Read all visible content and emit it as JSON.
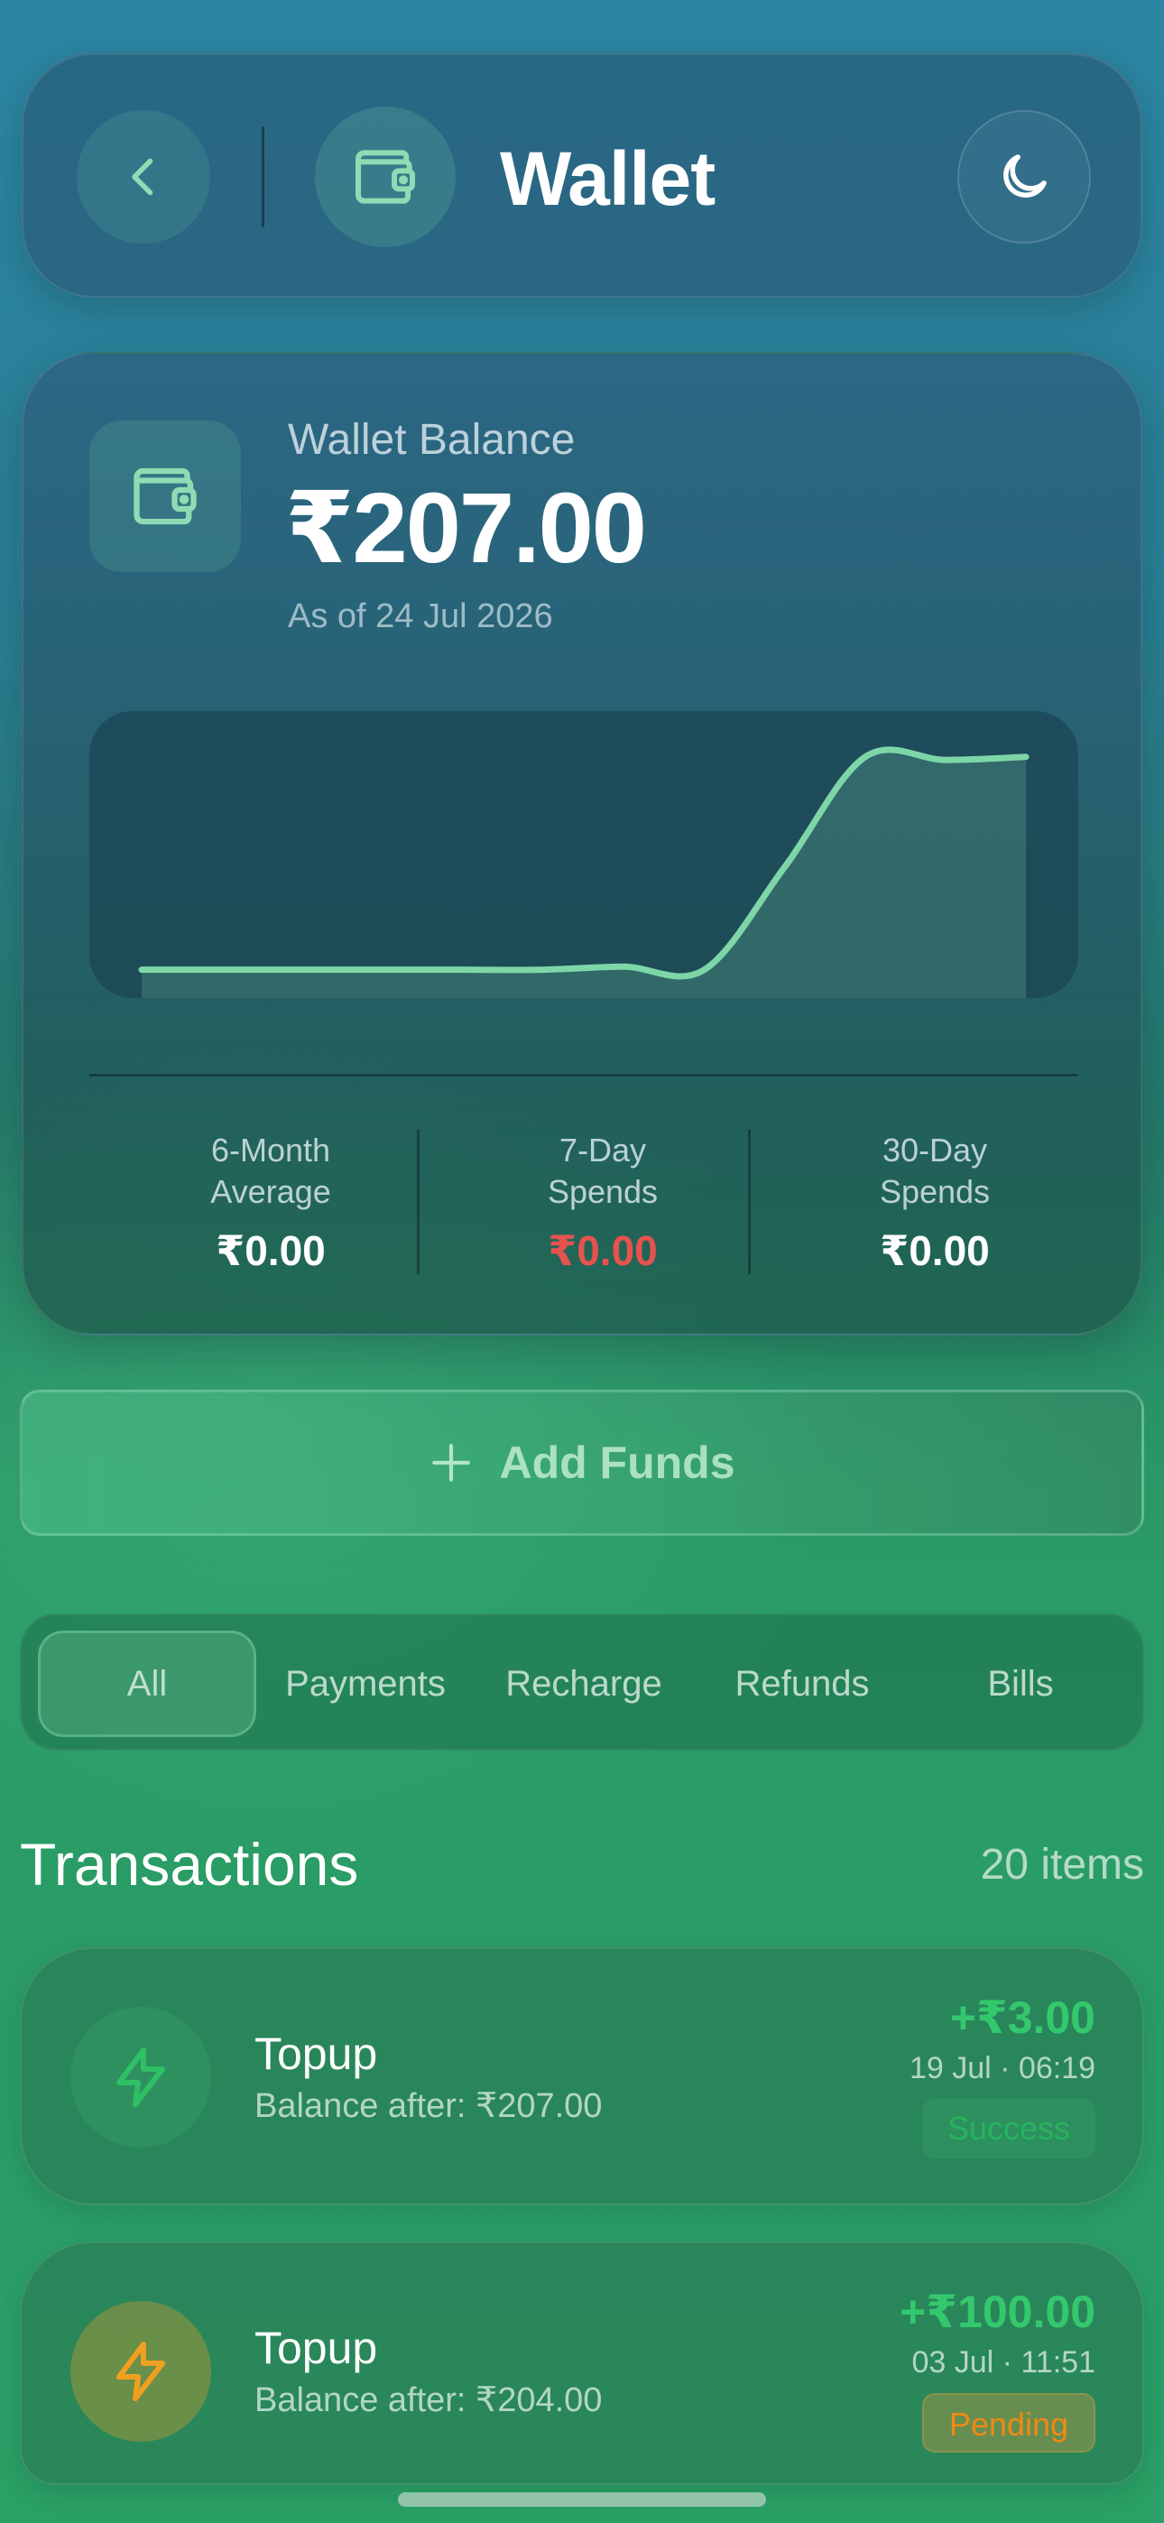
{
  "header": {
    "title": "Wallet",
    "back_icon": "chevron-left-icon",
    "wallet_icon": "wallet-icon",
    "theme_icon": "moon-icon"
  },
  "balance": {
    "label": "Wallet Balance",
    "amount": "₹207.00",
    "as_of": "As of 24 Jul 2026"
  },
  "chart_data": {
    "type": "area",
    "x": [
      0,
      1,
      2,
      3,
      4,
      5,
      6,
      7,
      8,
      9,
      10,
      11
    ],
    "values": [
      0,
      0,
      0,
      0,
      0,
      0,
      3,
      0,
      100,
      207,
      204,
      207
    ],
    "ylim": [
      -10,
      220
    ],
    "grid": false,
    "color": "#7ed6a8"
  },
  "stats": [
    {
      "label_line1": "6-Month",
      "label_line2": "Average",
      "value": "₹0.00"
    },
    {
      "label_line1": "7-Day",
      "label_line2": "Spends",
      "value": "₹0.00",
      "color": "#e8524e"
    },
    {
      "label_line1": "30-Day",
      "label_line2": "Spends",
      "value": "₹0.00"
    }
  ],
  "add_funds": {
    "label": "Add Funds",
    "icon": "plus-icon"
  },
  "tabs": [
    {
      "label": "All",
      "active": true
    },
    {
      "label": "Payments"
    },
    {
      "label": "Recharge"
    },
    {
      "label": "Refunds"
    },
    {
      "label": "Bills"
    }
  ],
  "transactions": {
    "title": "Transactions",
    "count": "20 items",
    "items": [
      {
        "name": "Topup",
        "balance_after": "Balance after: ₹207.00",
        "amount": "+₹3.00",
        "time": "19 Jul · 06:19",
        "status": "Success",
        "icon": "lightning-icon",
        "icon_color": "#2fbf65"
      },
      {
        "name": "Topup",
        "balance_after": "Balance after: ₹204.00",
        "amount": "+₹100.00",
        "time": "03 Jul · 11:51",
        "status": "Pending",
        "icon": "lightning-icon",
        "icon_color": "#f0a020"
      }
    ]
  },
  "colors": {
    "accent": "#7ed6a8",
    "positive": "#34c86e",
    "negative": "#e8524e",
    "pending": "#f08a12"
  }
}
